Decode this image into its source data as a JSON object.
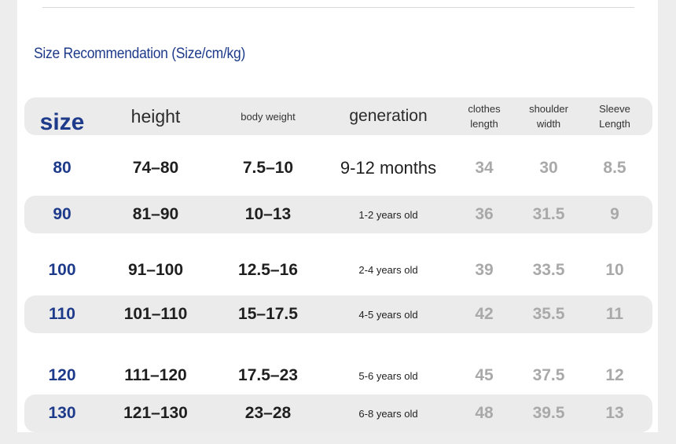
{
  "heading": "Size Recommendation (Size/cm/kg)",
  "columns": {
    "size": "size",
    "height": "height",
    "body_weight": "body weight",
    "generation": "generation",
    "clothes_length_1": "clothes",
    "clothes_length_2": "length",
    "shoulder_width_1": "shoulder",
    "shoulder_width_2": "width",
    "sleeve_length_1": "Sleeve",
    "sleeve_length_2": "Length"
  },
  "rows": [
    {
      "size": "80",
      "height": "74–80",
      "weight": "7.5–10",
      "generation": "9-12 months",
      "clothes": "34",
      "shoulder": "30",
      "sleeve": "8.5"
    },
    {
      "size": "90",
      "height": "81–90",
      "weight": "10–13",
      "generation": "1-2 years old",
      "clothes": "36",
      "shoulder": "31.5",
      "sleeve": "9"
    },
    {
      "size": "100",
      "height": "91–100",
      "weight": "12.5–16",
      "generation": "2-4 years old",
      "clothes": "39",
      "shoulder": "33.5",
      "sleeve": "10"
    },
    {
      "size": "110",
      "height": "101–110",
      "weight": "15–17.5",
      "generation": "4-5 years old",
      "clothes": "42",
      "shoulder": "35.5",
      "sleeve": "11"
    },
    {
      "size": "120",
      "height": "111–120",
      "weight": "17.5–23",
      "generation": "5-6 years old",
      "clothes": "45",
      "shoulder": "37.5",
      "sleeve": "12"
    },
    {
      "size": "130",
      "height": "121–130",
      "weight": "23–28",
      "generation": "6-8 years old",
      "clothes": "48",
      "shoulder": "39.5",
      "sleeve": "13"
    }
  ],
  "colors": {
    "accent_blue": "#1e3a8a",
    "row_shade": "#ebebeb",
    "measure_gray": "#a9a9a9"
  }
}
